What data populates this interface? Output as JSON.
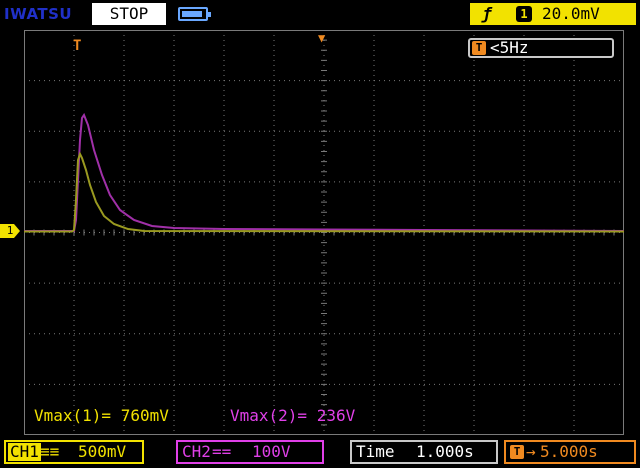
{
  "header": {
    "brand": "IWATSU",
    "run_state": "STOP",
    "battery_icon": "battery-icon",
    "trigger": {
      "edge_symbol": "ƒ",
      "channel": "1",
      "level": "20.0mV"
    }
  },
  "display": {
    "trigger_marker": "T",
    "trigger_position_marker": "▼",
    "channel1_ground_marker": "1",
    "frequency": {
      "icon": "T",
      "value": "<5Hz"
    },
    "measurements": {
      "ch1": "Vmax(1)= 760mV",
      "ch2": "Vmax(2)= 236V"
    },
    "colors": {
      "ch1": "#f2e200",
      "ch2": "#e040e8",
      "grid": "#7a7a7a",
      "trigger": "#f08a20"
    }
  },
  "footer": {
    "ch1": {
      "label": "CH1",
      "coupling": "≡≡",
      "scale": "500mV"
    },
    "ch2": {
      "label": "CH2",
      "coupling": "==",
      "scale": "100V"
    },
    "timebase": {
      "label": "Time",
      "value": "1.000s"
    },
    "delay": {
      "icon": "T",
      "arrow": "→",
      "value": "5.000s"
    }
  }
}
